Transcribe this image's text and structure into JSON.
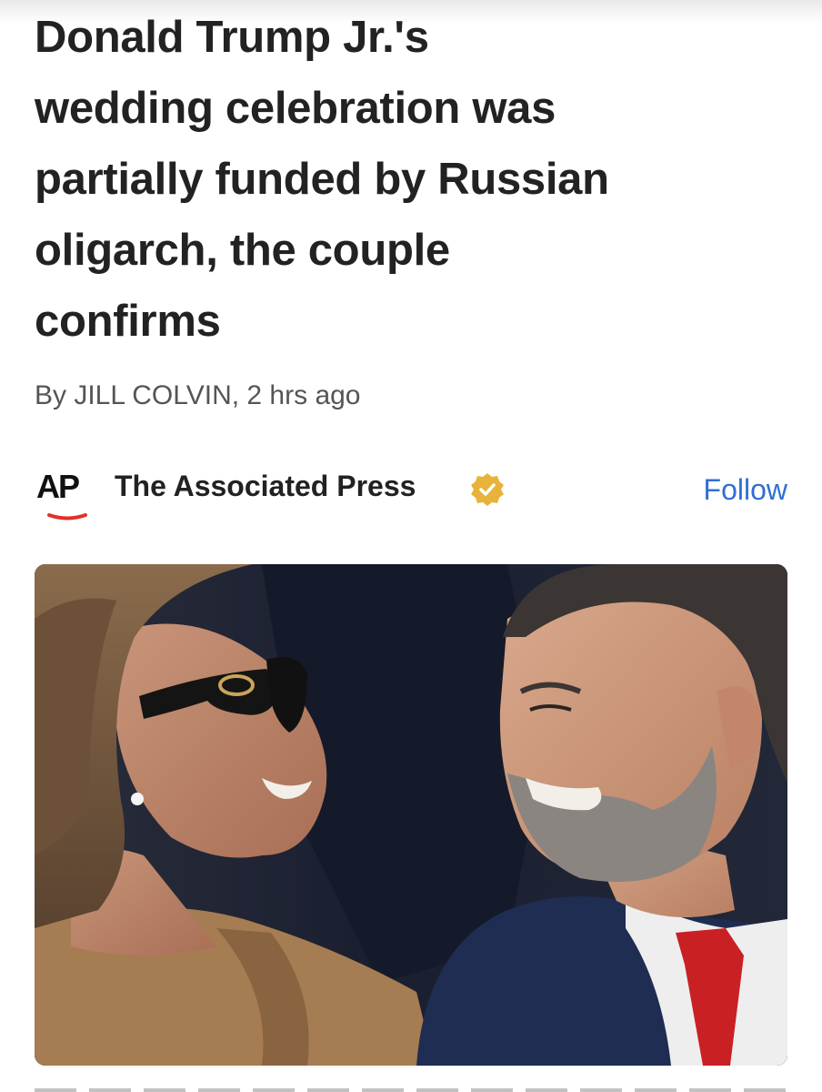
{
  "article": {
    "headline_lines": [
      "Donald Trump Jr.'s",
      "wedding celebration was",
      "partially funded by Russian",
      "oligarch, the couple",
      "confirms"
    ],
    "byline": "By JILL COLVIN,  2 hrs ago"
  },
  "publisher": {
    "logo_text": "AP",
    "name": "The Associated Press",
    "verified_icon": "verified-badge-icon",
    "follow_label": "Follow"
  },
  "colors": {
    "follow_link": "#2f6fd6",
    "ap_underline": "#e0312a",
    "verified_badge": "#e8b33b"
  }
}
